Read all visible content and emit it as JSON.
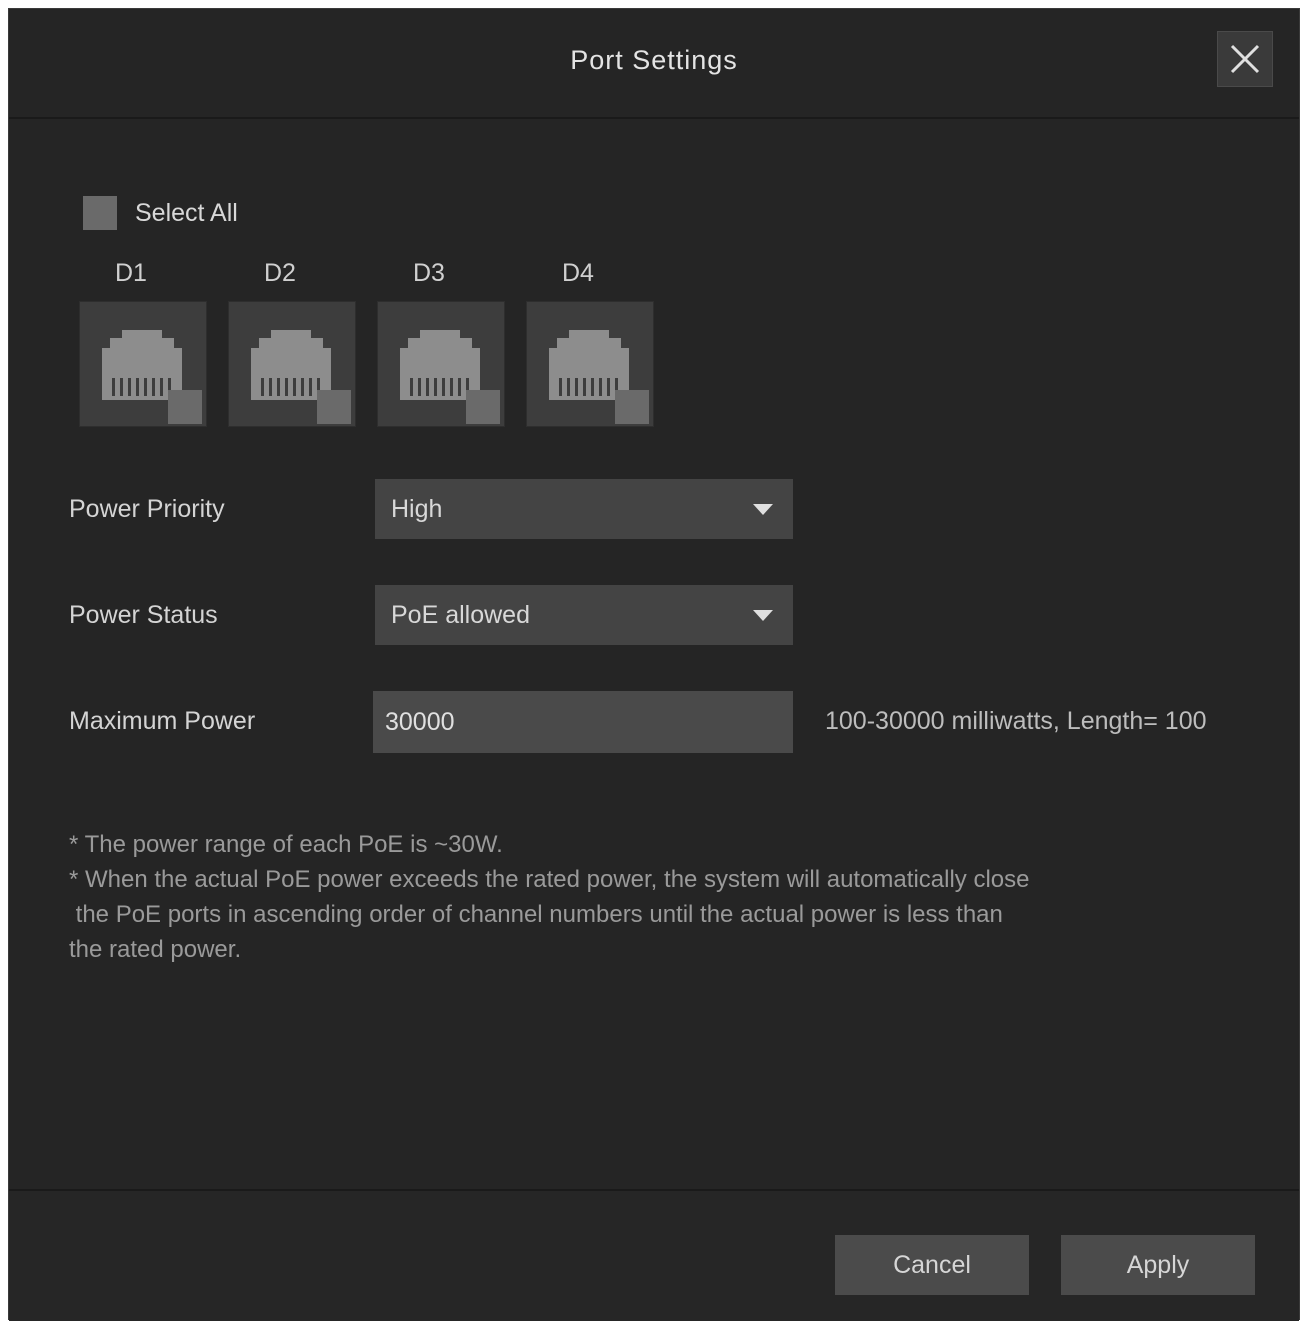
{
  "dialog": {
    "title": "Port Settings",
    "close_icon": "close-icon"
  },
  "select_all": {
    "label": "Select All",
    "checked": false
  },
  "ports": [
    {
      "label": "D1",
      "icon": "ethernet-port-icon",
      "checked": false
    },
    {
      "label": "D2",
      "icon": "ethernet-port-icon",
      "checked": false
    },
    {
      "label": "D3",
      "icon": "ethernet-port-icon",
      "checked": false
    },
    {
      "label": "D4",
      "icon": "ethernet-port-icon",
      "checked": false
    }
  ],
  "form": {
    "power_priority": {
      "label": "Power Priority",
      "value": "High"
    },
    "power_status": {
      "label": "Power Status",
      "value": "PoE allowed"
    },
    "maximum_power": {
      "label": "Maximum Power",
      "value": "30000",
      "hint": "100-30000 milliwatts, Length= 100"
    }
  },
  "notes": [
    "* The power range of each PoE is ~30W.",
    "* When the actual PoE power exceeds the rated power, the system will automatically close",
    " the PoE ports in ascending order of channel numbers until the actual power is less than",
    "the rated power."
  ],
  "footer": {
    "cancel_label": "Cancel",
    "apply_label": "Apply"
  },
  "colors": {
    "background": "#252525",
    "control": "#444444",
    "text": "#d4d4d4"
  }
}
